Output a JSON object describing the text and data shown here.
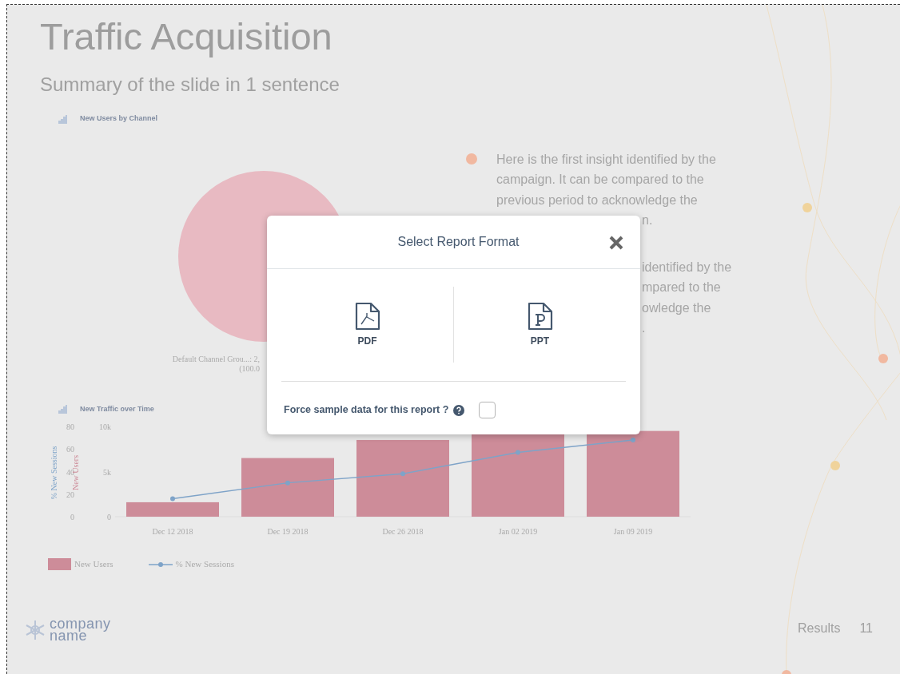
{
  "slide": {
    "title": "Traffic Acquisition",
    "subtitle": "Summary of the slide in 1 sentence"
  },
  "pie_panel": {
    "title": "New Users by Channel",
    "label_lines": [
      "Default Channel Grou...: 2,",
      "(100.0"
    ]
  },
  "insights": [
    {
      "lines": [
        "Here is the first insight identified by the",
        "campaign. It can be compared to the",
        "previous period to acknowledge the"
      ],
      "tail": [
        "n."
      ]
    },
    {
      "tail": [
        "identified by the",
        "mpared to the",
        "owledge the",
        "."
      ]
    }
  ],
  "traffic_panel": {
    "title": "New Traffic over Time",
    "chart_data": {
      "type": "bar",
      "categories": [
        "Dec 12 2018",
        "Dec 19 2018",
        "Dec 26 2018",
        "Jan 02 2019",
        "Jan 09 2019"
      ],
      "series": [
        {
          "name": "New Users",
          "color": "#cd8c99",
          "values": [
            1600,
            6500,
            8500,
            9300,
            9500
          ]
        },
        {
          "name": "% New Sessions",
          "type": "line",
          "axis": "y2",
          "marker": true,
          "color": "#7ea3c8",
          "values": [
            16,
            30,
            38,
            57,
            68
          ]
        }
      ],
      "ylabel": "New Users",
      "y2label": "% New Sessions",
      "yticks": [
        0,
        {
          "value": 5000,
          "label": "5k"
        },
        {
          "value": 10000,
          "label": "10k"
        }
      ],
      "y2ticks": [
        0,
        20,
        40,
        60,
        80
      ],
      "ylim": [
        0,
        10000
      ],
      "y2lim": [
        0,
        80
      ]
    }
  },
  "footer": {
    "logo_lines": [
      "company",
      "name"
    ],
    "section": "Results",
    "page": "11"
  },
  "modal": {
    "title": "Select Report Format",
    "options": [
      {
        "kind": "pdf",
        "label": "PDF"
      },
      {
        "kind": "ppt",
        "label": "PPT"
      }
    ],
    "option_label": "Force sample data for this report ?",
    "checked": false
  }
}
